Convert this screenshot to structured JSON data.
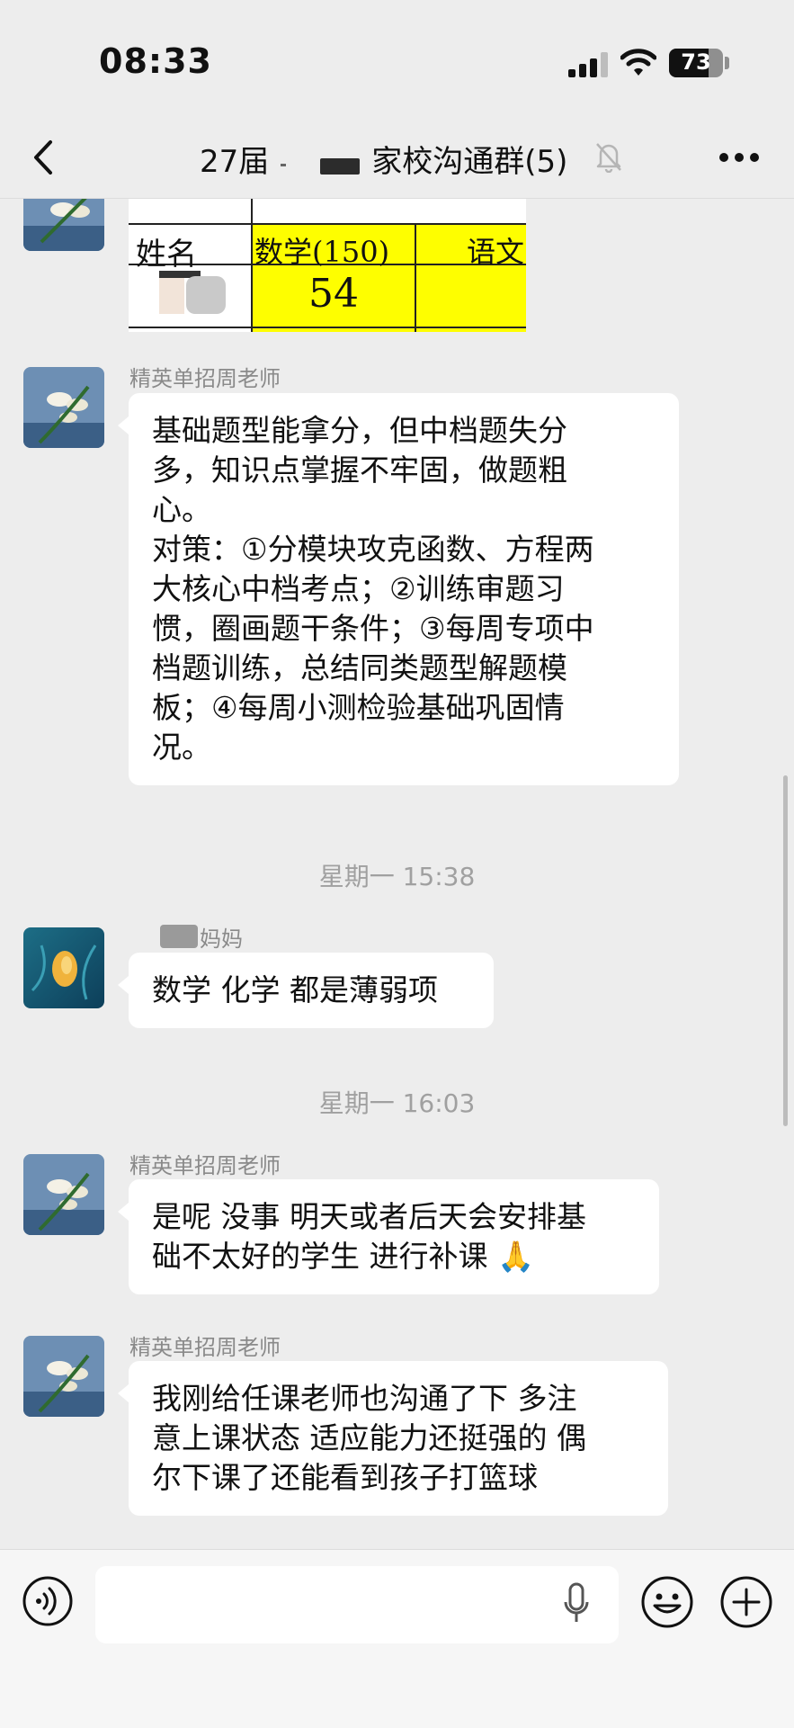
{
  "status_bar": {
    "time": "08:33",
    "battery": "73",
    "battery_level": 0.73
  },
  "header": {
    "title_prefix": "27届",
    "title_suffix": "家校沟通群(5)",
    "icons": [
      "back-icon",
      "mute-bell-icon",
      "more-icon"
    ]
  },
  "score_image": {
    "col_name": "姓名",
    "col_math": "数学(150)",
    "col_chinese": "语文",
    "math_score": "54"
  },
  "messages": [
    {
      "sender": "精英单招周老师",
      "lines": [
        "基础题型能拿分，但中档题失分",
        "多，知识点掌握不牢固，做题粗",
        "心。",
        "对策：①分模块攻克函数、方程两",
        "大核心中档考点；②训练审题习",
        "惯，圈画题干条件；③每周专项中",
        "档题训练，总结同类题型解题模",
        "板；④每周小测检验基础巩固情",
        "况。"
      ]
    },
    {
      "timestamp": "星期一 15:38"
    },
    {
      "sender": "妈妈",
      "lines": [
        "数学 化学 都是薄弱项"
      ]
    },
    {
      "timestamp": "星期一 16:03"
    },
    {
      "sender": "精英单招周老师",
      "lines": [
        "是呢 没事 明天或者后天会安排基",
        "础不太好的学生 进行补课 🙏"
      ]
    },
    {
      "sender": "精英单招周老师",
      "lines": [
        "我刚给任课老师也沟通了下 多注",
        "意上课状态  适应能力还挺强的 偶",
        "尔下课了还能看到孩子打篮球"
      ]
    }
  ],
  "input_bar": {
    "icons": [
      "voice-icon",
      "microphone-icon",
      "emoji-icon",
      "plus-icon"
    ]
  }
}
